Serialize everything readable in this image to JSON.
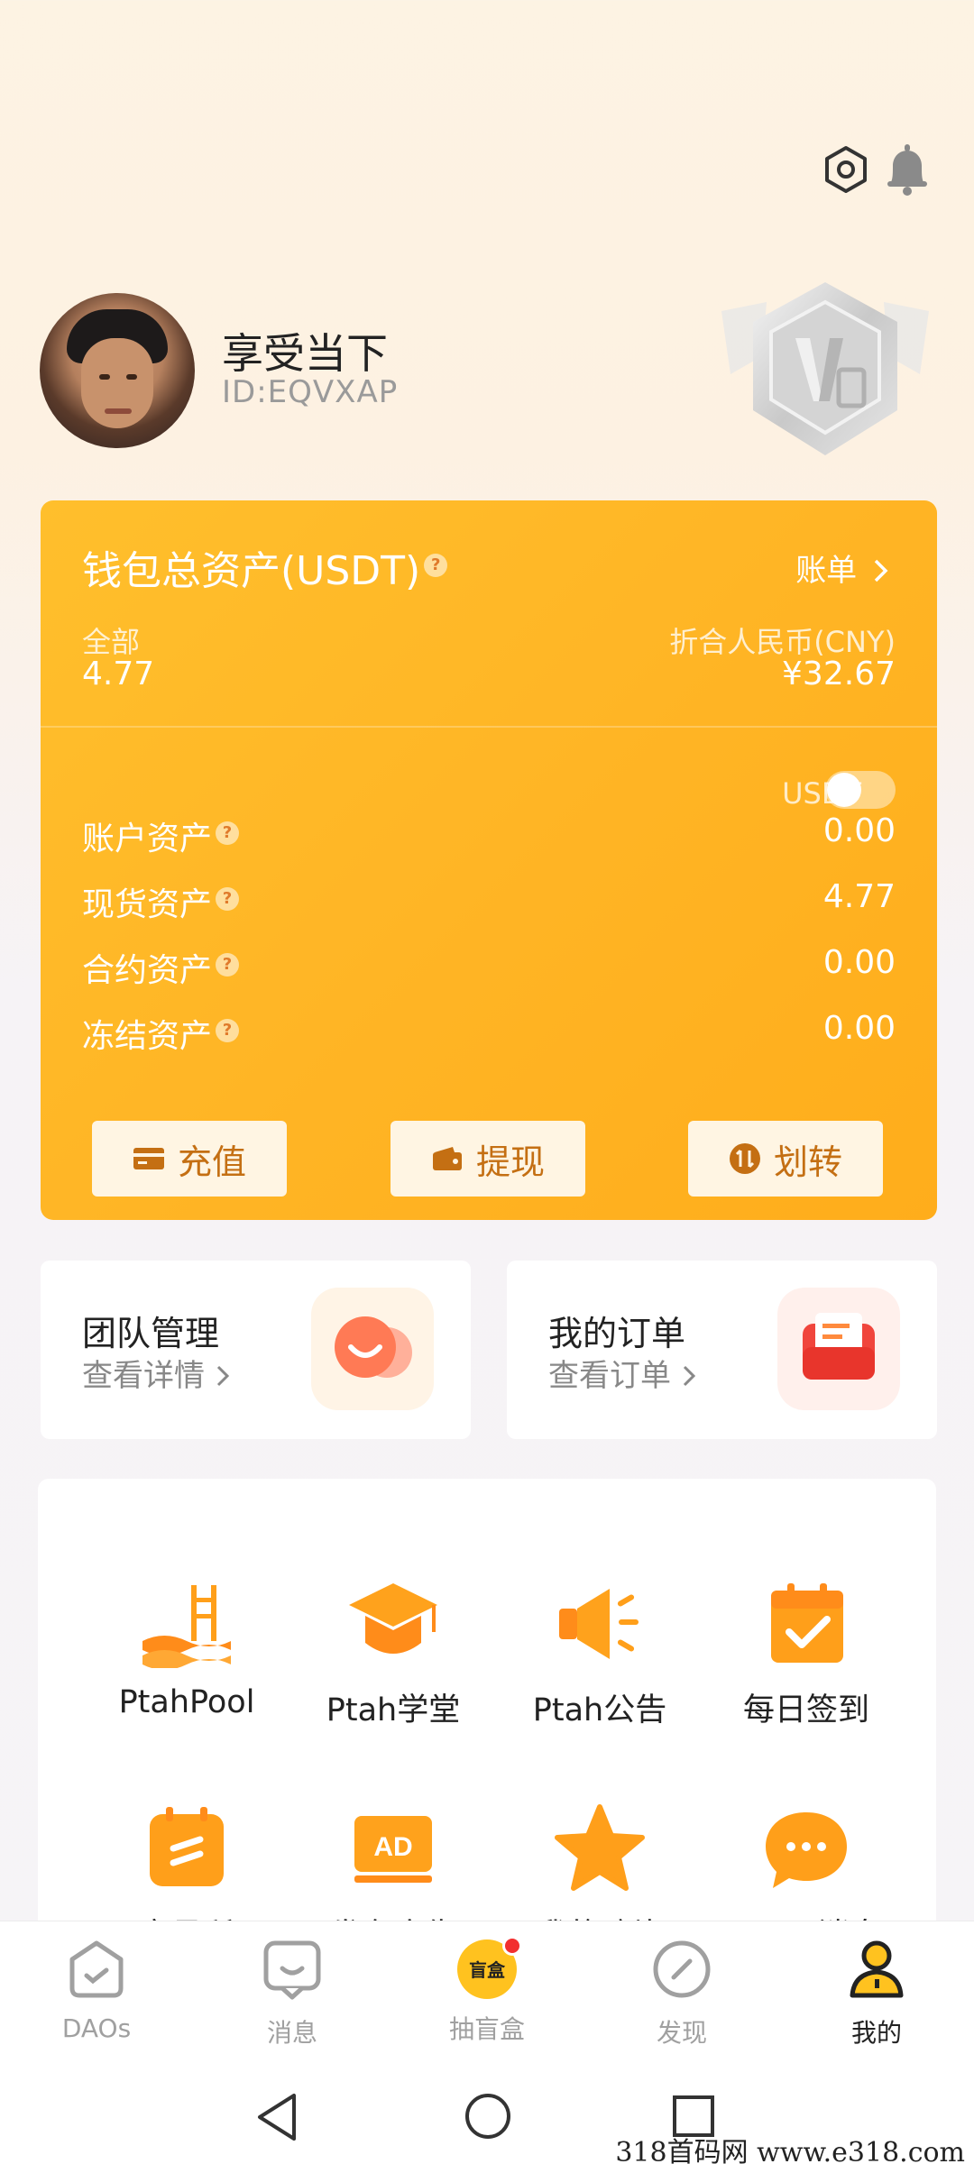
{
  "icons": {
    "settings": "hexagon-settings-icon",
    "notifications": "bell-icon"
  },
  "profile": {
    "name": "享受当下",
    "id": "ID:EQVXAP"
  },
  "wallet": {
    "title": "钱包总资产(USDT)",
    "question_mark": "?",
    "bill_link": "账单",
    "total_label": "全部",
    "total_value": "4.77",
    "cny_label": "折合人民币(CNY)",
    "cny_value": "¥32.67",
    "toggle_label": "USDT",
    "toggle_on": false,
    "assets": [
      {
        "label": "账户资产",
        "value": "0.00"
      },
      {
        "label": "现货资产",
        "value": "4.77"
      },
      {
        "label": "合约资产",
        "value": "0.00"
      },
      {
        "label": "冻结资产",
        "value": "0.00"
      }
    ],
    "buttons": {
      "recharge": "充值",
      "withdraw": "提现",
      "transfer": "划转"
    }
  },
  "cards": {
    "team": {
      "title": "团队管理",
      "subtitle": "查看详情"
    },
    "orders": {
      "title": "我的订单",
      "subtitle": "查看订单"
    }
  },
  "grid": {
    "row1": [
      "PtahPool",
      "Ptah学堂",
      "Ptah公告",
      "每日签到"
    ],
    "row2": [
      "交易所",
      "发布广告",
      "我的碎片",
      "DAOs消息"
    ]
  },
  "nav": [
    {
      "label": "DAOs",
      "icon": "daos-icon"
    },
    {
      "label": "消息",
      "icon": "message-icon"
    },
    {
      "label": "抽盲盒",
      "icon": "blind-box-icon",
      "badge_text": "盲盒"
    },
    {
      "label": "发现",
      "icon": "discover-icon"
    },
    {
      "label": "我的",
      "icon": "profile-icon",
      "active": true
    }
  ],
  "watermark": "318首码网 www.e318.com",
  "colors": {
    "accent": "#ffb525",
    "button_text": "#c46f13",
    "icon_orange": "#ff9f1a"
  }
}
